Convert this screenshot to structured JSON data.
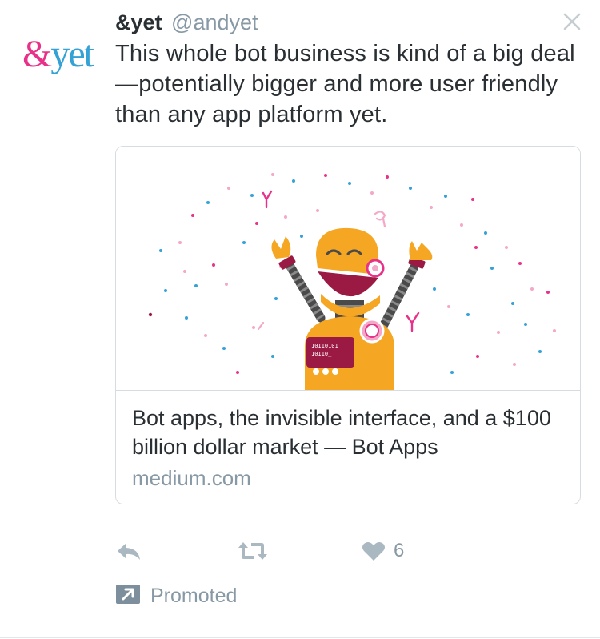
{
  "tweet": {
    "avatar": {
      "logo_amp": "&",
      "logo_rest": "yet"
    },
    "author_name": "&yet",
    "author_handle": "@andyet",
    "text": "This whole bot business is kind of a big deal—potentially bigger and more user friendly than any app platform yet.",
    "close_icon": "close-icon"
  },
  "card": {
    "image_alt": "robot-celebrating-illustration",
    "robot_screen_line1": "10110101",
    "robot_screen_line2": "10110_",
    "title": "Bot apps, the invisible interface, and a $100 billion dollar market — Bot Apps",
    "domain": "medium.com"
  },
  "actions": {
    "reply_icon": "reply-icon",
    "retweet_icon": "retweet-icon",
    "like_icon": "heart-icon",
    "like_count": "6"
  },
  "promoted": {
    "icon": "promoted-arrow-icon",
    "label": "Promoted"
  },
  "colors": {
    "text": "#292f33",
    "muted": "#8899a6",
    "border": "#d6dde2",
    "brand_pink": "#e8328a",
    "brand_blue": "#35a2d6",
    "robot_orange": "#f5a623",
    "robot_dark": "#9b1a44"
  }
}
